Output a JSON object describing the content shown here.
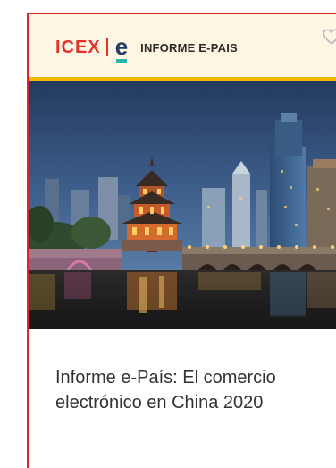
{
  "card": {
    "brand": {
      "logo_text": "ICEX",
      "sub_logo_text": "e",
      "label": "INFORME E-PAIS"
    },
    "favorite_icon": "heart-outline-icon",
    "image_icon": "city-skyline-night-photo",
    "title": "Informe e-País: El comercio electrónico en China 2020",
    "colors": {
      "border": "#d9262e",
      "header_bg": "#fdf6e3",
      "header_accent": "#f4b400",
      "icex_red": "#e4322b",
      "e_navy": "#1f3d66",
      "e_teal": "#2db3a5"
    }
  }
}
